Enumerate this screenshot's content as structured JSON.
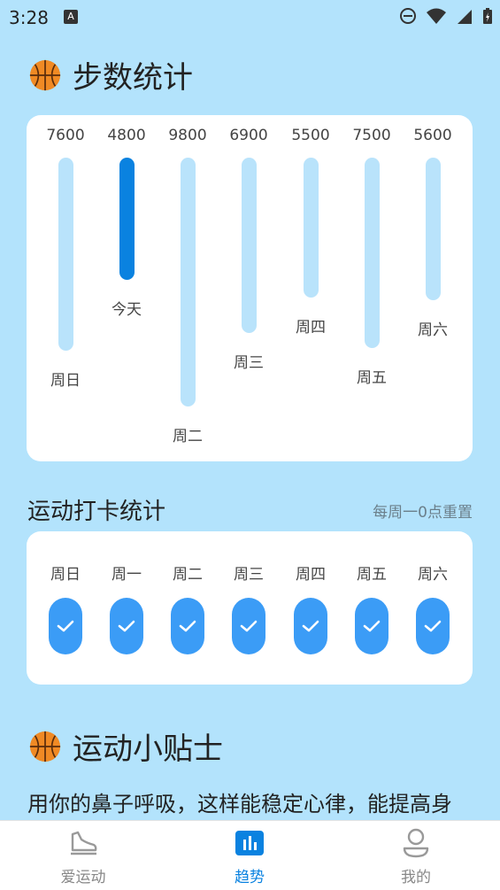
{
  "status_bar": {
    "time": "3:28",
    "notification_letter": "A"
  },
  "steps_section": {
    "title": "步数统计"
  },
  "steps_chart": {
    "today_label": "今天",
    "bars": [
      {
        "day": "周日",
        "value": "7600",
        "today": false
      },
      {
        "day": "今天",
        "value": "4800",
        "today": true
      },
      {
        "day": "周二",
        "value": "9800",
        "today": false
      },
      {
        "day": "周三",
        "value": "6900",
        "today": false
      },
      {
        "day": "周四",
        "value": "5500",
        "today": false
      },
      {
        "day": "周五",
        "value": "7500",
        "today": false
      },
      {
        "day": "周六",
        "value": "5600",
        "today": false
      }
    ]
  },
  "checkin": {
    "title": "运动打卡统计",
    "note": "每周一0点重置",
    "days": [
      "周日",
      "周一",
      "周二",
      "周三",
      "周四",
      "周五",
      "周六"
    ]
  },
  "tips": {
    "title": "运动小贴士",
    "text": "用你的鼻子呼吸，这样能稳定心律，能提高身"
  },
  "nav": {
    "items": [
      {
        "label": "爱运动",
        "icon": "shoe-icon",
        "active": false
      },
      {
        "label": "趋势",
        "icon": "chart-icon",
        "active": true
      },
      {
        "label": "我的",
        "icon": "user-icon",
        "active": false
      }
    ]
  },
  "colors": {
    "background": "#b3e3fc",
    "track": "#b9e3fb",
    "today_bar": "#0a82e0",
    "check": "#3b9cf6",
    "nav_active": "#0a82e0"
  }
}
